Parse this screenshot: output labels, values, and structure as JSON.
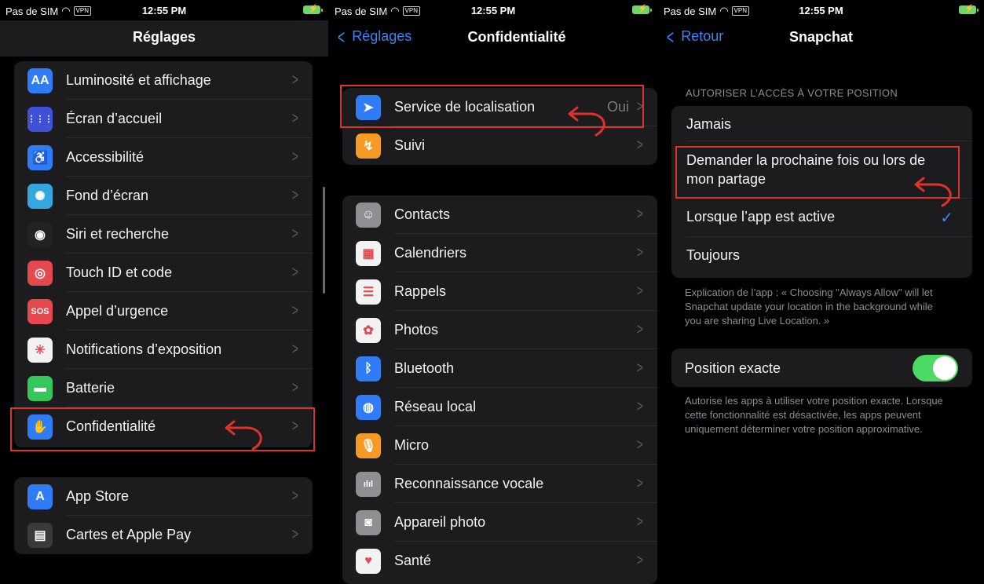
{
  "status_bar": {
    "carrier": "Pas de SIM",
    "vpn": "VPN",
    "time": "12:55 PM"
  },
  "panel1": {
    "title": "Réglages",
    "group1": [
      {
        "label": "Luminosité et affichage",
        "icon": "text-size-icon",
        "color": "#2f7cf6",
        "glyph": "AA"
      },
      {
        "label": "Écran d’accueil",
        "icon": "home-grid-icon",
        "color": "#3f51d8",
        "glyph": "⋮⋮⋮"
      },
      {
        "label": "Accessibilité",
        "icon": "accessibility-icon",
        "color": "#2f7cf6",
        "glyph": "♿"
      },
      {
        "label": "Fond d’écran",
        "icon": "wallpaper-icon",
        "color": "#35a7e0",
        "glyph": "✺"
      },
      {
        "label": "Siri et recherche",
        "icon": "siri-icon",
        "color": "#222",
        "glyph": "◉"
      },
      {
        "label": "Touch ID et code",
        "icon": "fingerprint-icon",
        "color": "#e5484d",
        "glyph": "◎"
      },
      {
        "label": "Appel d’urgence",
        "icon": "sos-icon",
        "color": "#e5484d",
        "glyph": "SOS"
      },
      {
        "label": "Notifications d’exposition",
        "icon": "exposure-icon",
        "color": "#f2f2f2",
        "glyph": "✳"
      },
      {
        "label": "Batterie",
        "icon": "battery-icon",
        "color": "#34c759",
        "glyph": "▬"
      },
      {
        "label": "Confidentialité",
        "icon": "privacy-hand-icon",
        "color": "#2f7cf6",
        "glyph": "✋"
      }
    ],
    "group2": [
      {
        "label": "App Store",
        "icon": "app-store-icon",
        "color": "#2f7cf6",
        "glyph": "A"
      },
      {
        "label": "Cartes et Apple Pay",
        "icon": "wallet-icon",
        "color": "#3a3a3c",
        "glyph": "▤"
      }
    ]
  },
  "panel2": {
    "back": "Réglages",
    "title": "Confidentialité",
    "group1": [
      {
        "label": "Service de localisation",
        "value": "Oui",
        "icon": "location-arrow-icon",
        "color": "#2f7cf6",
        "glyph": "➤"
      },
      {
        "label": "Suivi",
        "value": "",
        "icon": "tracking-icon",
        "color": "#f59b23",
        "glyph": "↯"
      }
    ],
    "group2": [
      {
        "label": "Contacts",
        "icon": "contacts-icon",
        "color": "#8e8e93",
        "glyph": "☺"
      },
      {
        "label": "Calendriers",
        "icon": "calendar-icon",
        "color": "#f2f2f2",
        "glyph": "▦"
      },
      {
        "label": "Rappels",
        "icon": "reminders-icon",
        "color": "#f2f2f2",
        "glyph": "☰"
      },
      {
        "label": "Photos",
        "icon": "photos-icon",
        "color": "#f2f2f2",
        "glyph": "✿"
      },
      {
        "label": "Bluetooth",
        "icon": "bluetooth-icon",
        "color": "#2f7cf6",
        "glyph": "ᛒ"
      },
      {
        "label": "Réseau local",
        "icon": "globe-icon",
        "color": "#2f7cf6",
        "glyph": "◍"
      },
      {
        "label": "Micro",
        "icon": "microphone-icon",
        "color": "#f59b23",
        "glyph": "🎙"
      },
      {
        "label": "Reconnaissance vocale",
        "icon": "waveform-icon",
        "color": "#8e8e93",
        "glyph": "ılıl"
      },
      {
        "label": "Appareil photo",
        "icon": "camera-icon",
        "color": "#8e8e93",
        "glyph": "◙"
      },
      {
        "label": "Santé",
        "icon": "health-heart-icon",
        "color": "#f2f2f2",
        "glyph": "♥"
      }
    ]
  },
  "panel3": {
    "back": "Retour",
    "title": "Snapchat",
    "section_header": "AUTORISER L’ACCÈS À VOTRE POSITION",
    "options": [
      {
        "label": "Jamais",
        "selected": false
      },
      {
        "label": "Demander la prochaine fois ou lors de mon partage",
        "selected": false
      },
      {
        "label": "Lorsque l’app est active",
        "selected": true
      },
      {
        "label": "Toujours",
        "selected": false
      }
    ],
    "explanation": "Explication de l’app : « Choosing \"Always Allow\" will let Snapchat update your location in the background while you are sharing Live Location. »",
    "precise_label": "Position exacte",
    "precise_on": true,
    "precise_footnote": "Autorise les apps à utiliser votre position exacte. Lorsque cette fonctionnalité est désactivée, les apps peuvent uniquement déterminer votre position approximative."
  },
  "colors": {
    "accent": "#3b82f6",
    "highlight": "#e0322c",
    "toggle_on": "#4cd964"
  }
}
